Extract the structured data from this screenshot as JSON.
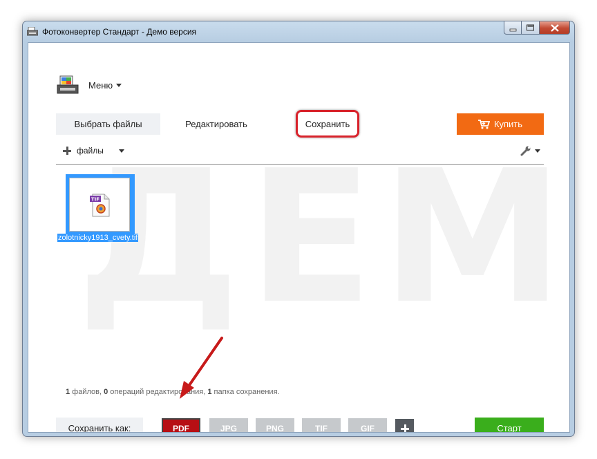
{
  "window": {
    "title": "Фотоконвертер Стандарт - Демо версия"
  },
  "watermark": "ДЕМО",
  "menu": {
    "label": "Меню"
  },
  "tabs": {
    "select_files": "Выбрать файлы",
    "edit": "Редактировать",
    "save": "Сохранить"
  },
  "buy_button": "Купить",
  "files_toolbar": {
    "label": "файлы"
  },
  "file": {
    "name": "zolotnicky1913_cvety.tif",
    "badge": "TIF"
  },
  "status": {
    "files_count": "1",
    "files_text": " файлов, ",
    "ops_count": "0",
    "ops_text": " операций редактирования, ",
    "folders_count": "1",
    "folders_text": " папка сохранения."
  },
  "save_as": {
    "label": "Сохранить как:",
    "formats": [
      "PDF",
      "JPG",
      "PNG",
      "TIF",
      "GIF"
    ],
    "selected": "PDF"
  },
  "start_button": "Старт",
  "colors": {
    "buy": "#f26a13",
    "start": "#3aae1c",
    "active_format": "#b70f14",
    "highlight": "#d8222b",
    "selection": "#3399ff"
  }
}
